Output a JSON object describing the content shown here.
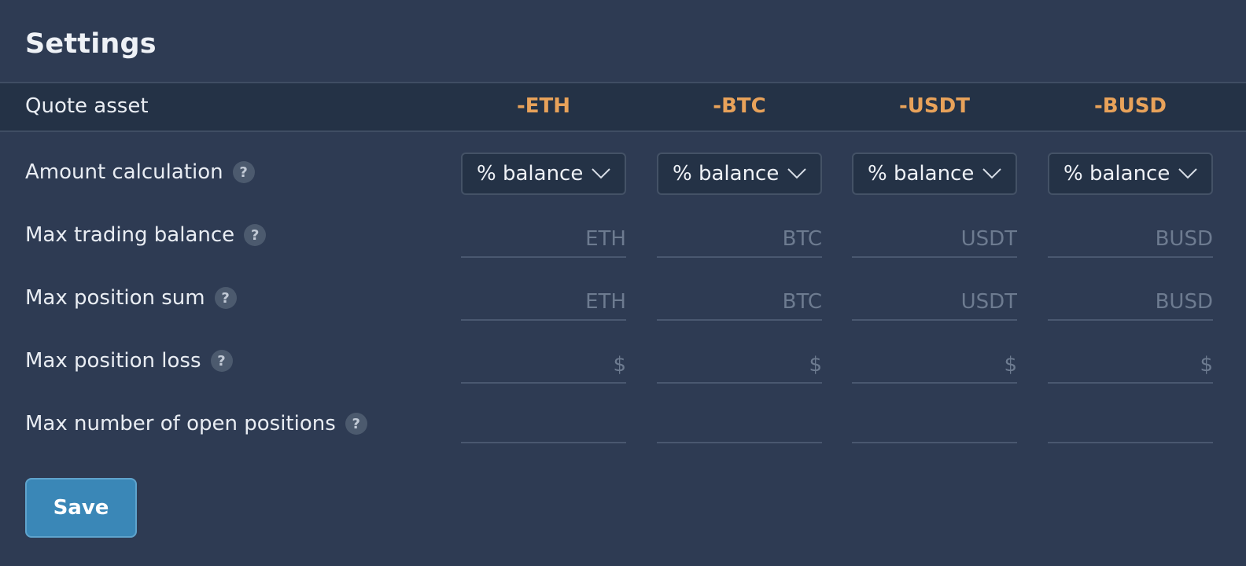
{
  "title": "Settings",
  "header": {
    "label": "Quote asset",
    "assets": [
      "-ETH",
      "-BTC",
      "-USDT",
      "-BUSD"
    ]
  },
  "rows": {
    "amount_calculation": {
      "label": "Amount calculation",
      "help": "?",
      "selects": [
        "% balance",
        "% balance",
        "% balance",
        "% balance"
      ]
    },
    "max_trading_balance": {
      "label": "Max trading balance",
      "help": "?",
      "placeholders": [
        "ETH",
        "BTC",
        "USDT",
        "BUSD"
      ]
    },
    "max_position_sum": {
      "label": "Max position sum",
      "help": "?",
      "placeholders": [
        "ETH",
        "BTC",
        "USDT",
        "BUSD"
      ]
    },
    "max_position_loss": {
      "label": "Max position loss",
      "help": "?",
      "placeholders": [
        "$",
        "$",
        "$",
        "$"
      ]
    },
    "max_open_positions": {
      "label": "Max number of open positions",
      "help": "?",
      "placeholders": [
        "",
        "",
        "",
        ""
      ]
    }
  },
  "save_label": "Save",
  "colors": {
    "background": "#2e3b53",
    "header_bg": "#243246",
    "asset_accent": "#e8a25a",
    "button": "#3a87b7"
  },
  "icons": {
    "help": "question-mark-circle",
    "dropdown": "chevron-down"
  }
}
